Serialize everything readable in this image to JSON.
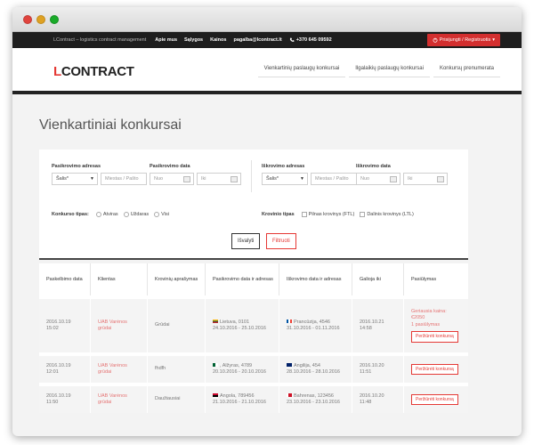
{
  "topbar": {
    "tagline": "LContract – logistics contract management",
    "links": [
      "Apie mus",
      "Sąlygos",
      "Kainos"
    ],
    "email": "pagalba@lcontract.lt",
    "phone": "+370 645 09592",
    "login_label": "Prisijungti / Registruotis"
  },
  "header": {
    "logo_accent": "L",
    "logo_rest": "CONTRACT",
    "nav": [
      "Vienkartinių paslaugų konkursai",
      "Ilgalaikių paslaugų konkursai",
      "Konkursų prenumerata"
    ]
  },
  "page": {
    "title": "Vienkartiniai konkursai"
  },
  "filters": {
    "pickup_address_label": "Pasikrovimo adresas",
    "pickup_date_label": "Pasikrovimo data",
    "unload_address_label": "Iškrovimo adresas",
    "unload_date_label": "Iškrovimo data",
    "country_value": "Šalis*",
    "city_placeholder": "Miestas / Pašto",
    "from_placeholder": "Nuo",
    "to_placeholder": "Iki",
    "tender_type_label": "Konkurso tipas:",
    "tender_types": [
      "Atviras",
      "Uždaras",
      "Visi"
    ],
    "cargo_type_label": "Krovinio tipas",
    "cargo_types": [
      "Pilnas krovinys (FTL)",
      "Dalinis krovinys (LTL)"
    ],
    "clear_label": "Išvalyti",
    "filter_label": "Filtruoti"
  },
  "table": {
    "headers": [
      "Paskelbimo data",
      "Klientas",
      "Krovinių aprašymas",
      "Pasikrovimo data ir adresas",
      "Iškrovimo data ir adresas",
      "Galioja iki",
      "Pasiūlymas"
    ],
    "rows": [
      {
        "date": "2016.10.19",
        "time": "15:02",
        "client_line1": "UAB Varėnos",
        "client_line2": "grūdai",
        "cargo": "Grūdai",
        "pickup_place": "Lietuva, 0101",
        "pickup_dates": "24.10.2016 - 25.10.2016",
        "pickup_flag_colors": [
          "#fdb913",
          "#006a44",
          "#c1272d"
        ],
        "unload_place": "Prancūzija, 4546",
        "unload_dates": "31.10.2016 - 01.11.2016",
        "unload_flag_colors": [
          "#0055a4",
          "#ffffff",
          "#ef4135"
        ],
        "valid_date": "2016.10.21",
        "valid_time": "14:58",
        "offer_line1": "Geriausia kaina:",
        "offer_line2": "€2050",
        "offer_line3": "1 pasiūlymas",
        "view_label": "Peržiūrėti konkursą"
      },
      {
        "date": "2016.10.19",
        "time": "12:01",
        "client_line1": "UAB Varėnos",
        "client_line2": "grūdai",
        "cargo": "fhdfh",
        "pickup_place": ", Alžyras, 4789",
        "pickup_dates": "20.10.2016 - 20.10.2016",
        "pickup_flag_colors": [
          "#006233",
          "#ffffff",
          "#d21034"
        ],
        "unload_place": "Angilija, 454",
        "unload_dates": "28.10.2016 - 28.10.2016",
        "unload_flag_colors": [
          "#012169",
          "#012169",
          "#c8102e"
        ],
        "valid_date": "2016.10.20",
        "valid_time": "11:51",
        "view_label": "Peržiūrėti konkursą"
      },
      {
        "date": "2016.10.19",
        "time": "11:50",
        "client_line1": "UAB Varėnos",
        "client_line2": "grūdai",
        "cargo": "Daužiausiai",
        "pickup_place": "Angola, 789456",
        "pickup_dates": "21.10.2016 - 21.10.2016",
        "pickup_flag_colors": [
          "#cc092f",
          "#000000",
          "#cc092f"
        ],
        "unload_place": "Bahrenas, 123456",
        "unload_dates": "23.10.2016 - 23.10.2016",
        "unload_flag_colors": [
          "#ce1126",
          "#ce1126",
          "#ffffff"
        ],
        "valid_date": "2016.10.20",
        "valid_time": "11:48",
        "view_label": "Peržiūrėti konkursą"
      }
    ]
  },
  "colors": {
    "accent": "#e53935",
    "topbar_bg": "#1e1e1e",
    "page_bg": "#f3f3f3"
  }
}
